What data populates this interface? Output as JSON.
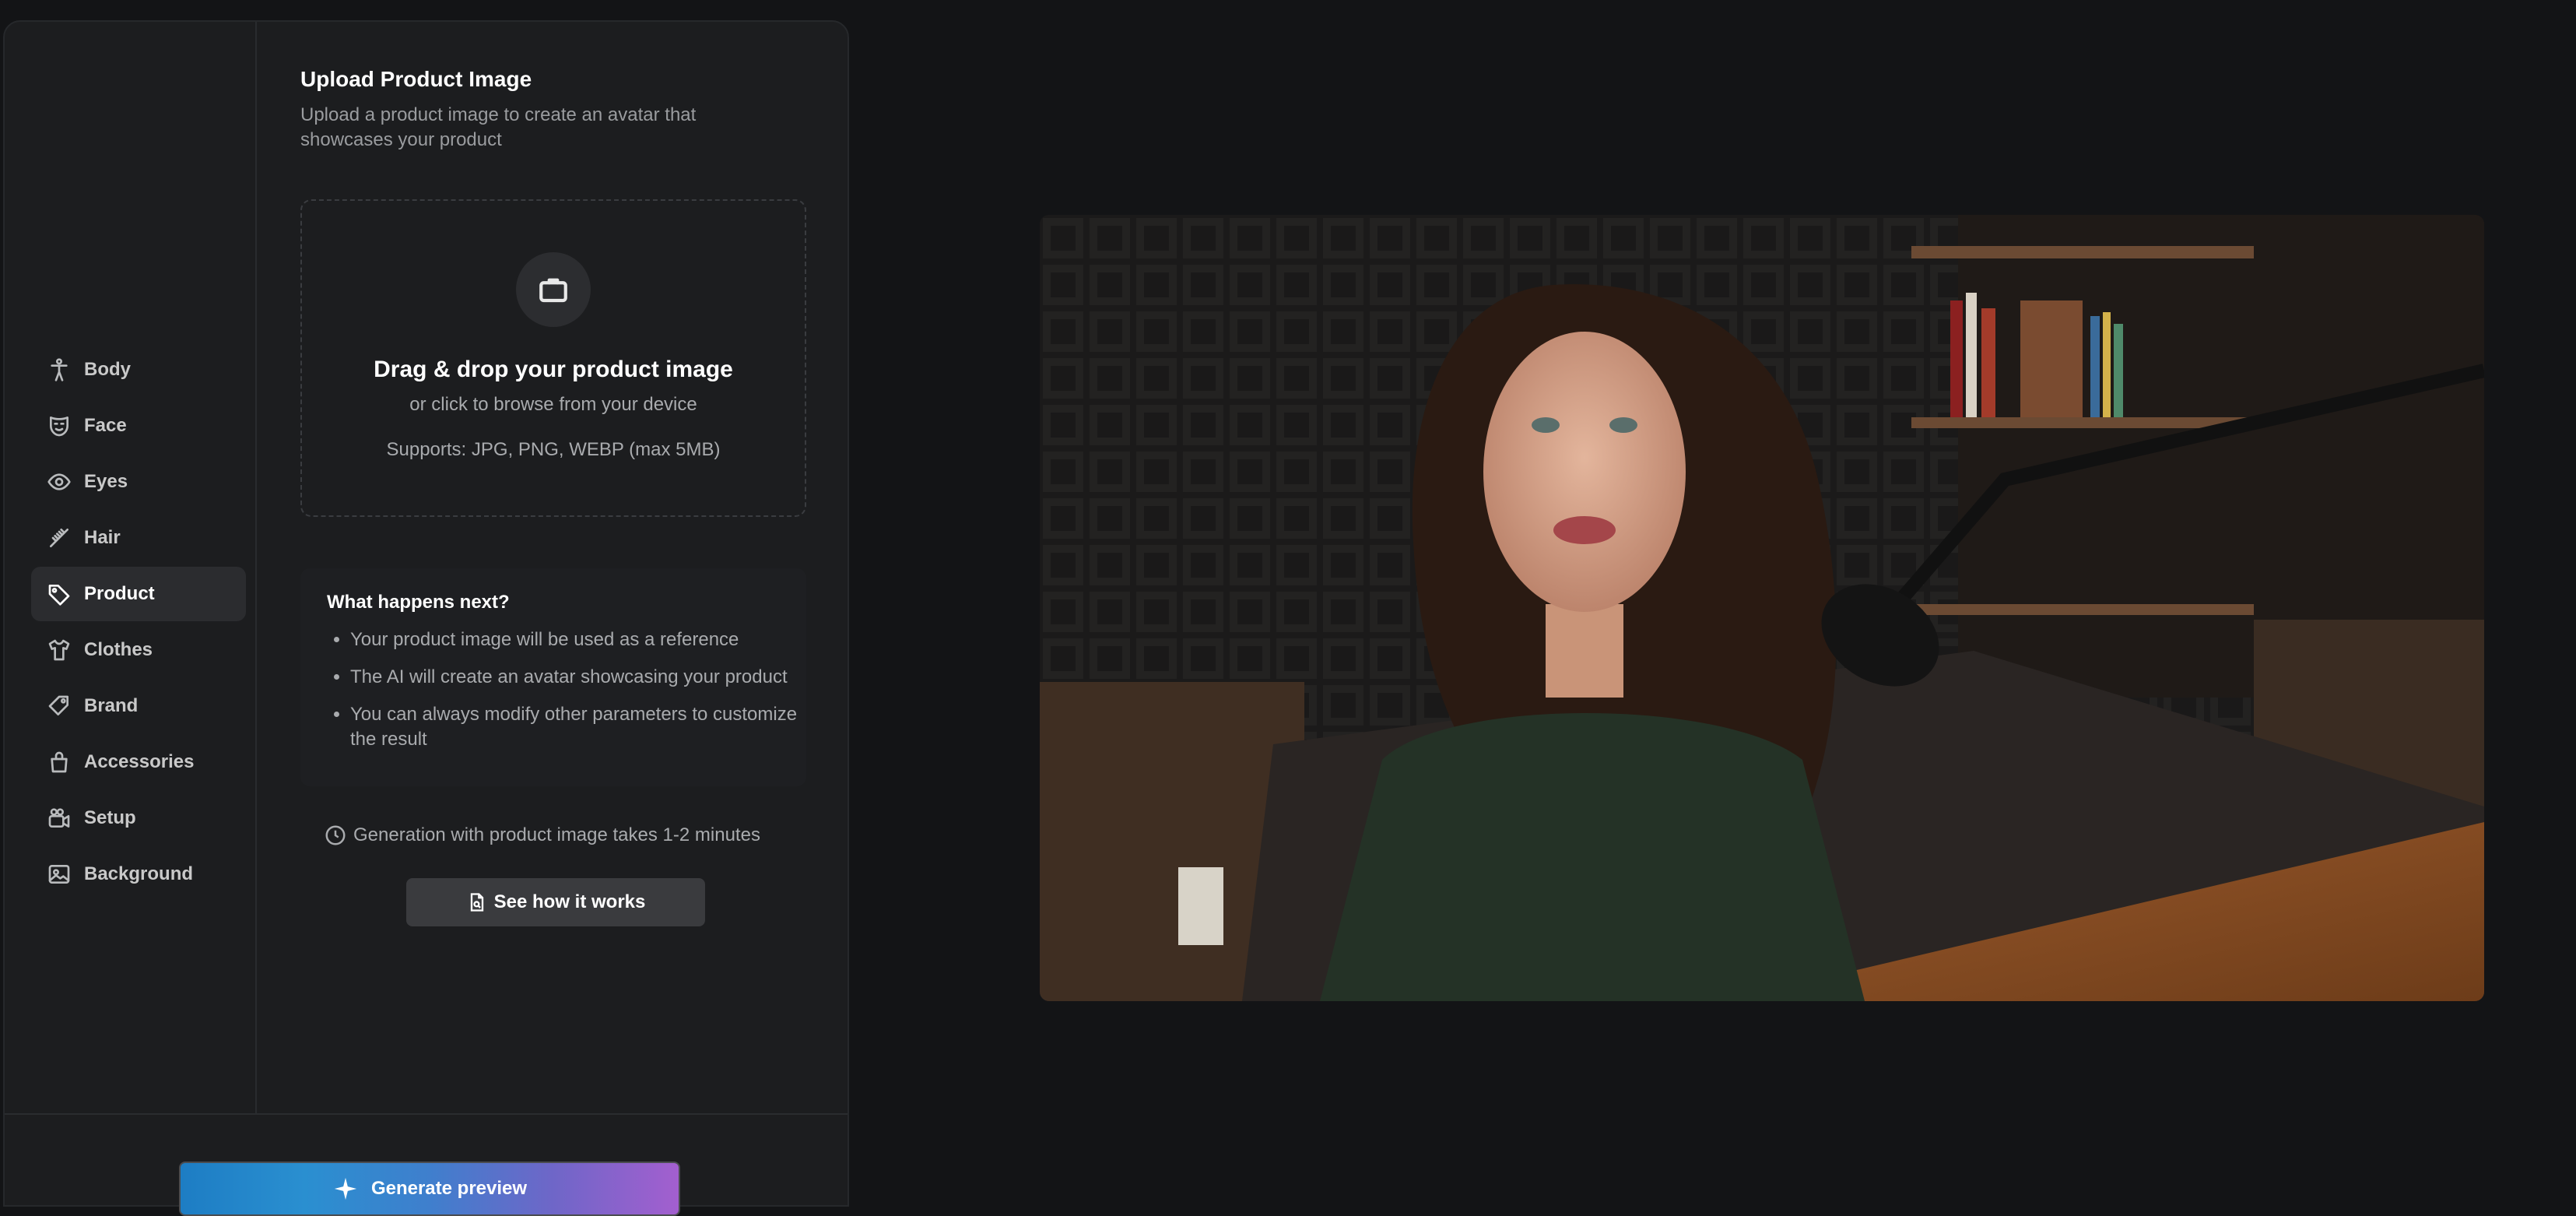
{
  "sidebar": {
    "items": [
      {
        "label": "Body",
        "icon": "body-icon"
      },
      {
        "label": "Face",
        "icon": "face-mask-icon"
      },
      {
        "label": "Eyes",
        "icon": "eye-icon"
      },
      {
        "label": "Hair",
        "icon": "hair-comb-icon"
      },
      {
        "label": "Product",
        "icon": "tag-icon",
        "active": true
      },
      {
        "label": "Clothes",
        "icon": "shirt-icon"
      },
      {
        "label": "Brand",
        "icon": "brand-tag-icon"
      },
      {
        "label": "Accessories",
        "icon": "bag-icon"
      },
      {
        "label": "Setup",
        "icon": "camera-icon"
      },
      {
        "label": "Background",
        "icon": "image-icon"
      }
    ]
  },
  "upload": {
    "title": "Upload Product Image",
    "subtitle": "Upload a product image to create an avatar that showcases your product",
    "drop_title": "Drag & drop your product image",
    "drop_sub": "or click to browse from your device",
    "supports": "Supports: JPG, PNG, WEBP (max 5MB)"
  },
  "next": {
    "title": "What happens next?",
    "items": [
      "Your product image will be used as a reference",
      "The AI will create an avatar showcasing your product",
      "You can always modify other parameters to customize the result"
    ]
  },
  "generation_time": "Generation with product image takes 1-2 minutes",
  "see_how_label": "See how it works",
  "generate_label": "Generate preview",
  "colors": {
    "background": "#131416",
    "panel": "#1c1d1f",
    "active_item": "#2b2c2f",
    "generate_gradient": [
      "#1d7dc4",
      "#a35fcf"
    ]
  }
}
